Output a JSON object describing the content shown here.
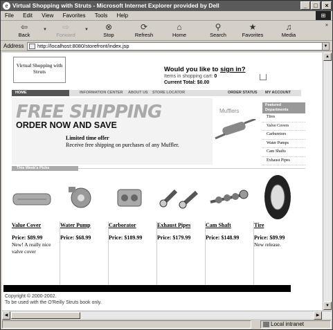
{
  "window": {
    "title": "Virtual Shopping with Struts - Microsoft Internet Explorer provided by Dell",
    "minimize": "_",
    "maximize": "□",
    "close": "×"
  },
  "menu": [
    "File",
    "Edit",
    "View",
    "Favorites",
    "Tools",
    "Help"
  ],
  "toolbar": {
    "back": "Back",
    "forward": "Forward",
    "stop": "Stop",
    "refresh": "Refresh",
    "home": "Home",
    "search": "Search",
    "favorites": "Favorites",
    "media": "Media"
  },
  "address": {
    "label": "Address",
    "url": "http://localhost:8080/storefront/index.jsp"
  },
  "header": {
    "logo": "Virtual Shopping with Struts",
    "question": "Would you like to",
    "signin": "sign in?",
    "cart_label": "Items in shopping cart:",
    "cart_count": "0",
    "total_label": "Current Total:",
    "total_value": "$0.00"
  },
  "nav": {
    "home": "HOME",
    "items": [
      "INFORMATION CENTER",
      "ABOUT US",
      "STORE LOCATOR"
    ],
    "right_items": [
      "ORDER STATUS",
      "MY ACCOUNT"
    ]
  },
  "banner": {
    "headline": "FREE SHIPPING",
    "subhead": "ORDER NOW AND SAVE",
    "offer_title": "Limited time offer",
    "offer_text": "Receive free shipping on purchases of any Muffler.",
    "product_label": "Mufflers"
  },
  "featured": {
    "heading": "Featured Departments",
    "items": [
      "Tires",
      "Valve Covers",
      "Carburetors",
      "Water Pumps",
      "Cam Shafts",
      "Exhaust Pipes"
    ]
  },
  "picks": {
    "heading": "This Week's Picks"
  },
  "products": [
    {
      "name": "Value Cover",
      "price": "Price: $89.99",
      "desc": "New! A really nice valve cover"
    },
    {
      "name": "Water Pump",
      "price": "Price: $68.99",
      "desc": ""
    },
    {
      "name": "Carborator",
      "price": "Price: $189.99",
      "desc": ""
    },
    {
      "name": "Exhaust Pipes",
      "price": "Price: $179.99",
      "desc": ""
    },
    {
      "name": "Cam Shaft",
      "price": "Price: $148.99",
      "desc": ""
    },
    {
      "name": "Tire",
      "price": "Price: $89.99",
      "desc": "New release."
    }
  ],
  "footer": {
    "copyright": "Copyright © 2000-2002.",
    "note": "To be used with the O'Reilly Struts book only."
  },
  "status": {
    "zone": "Local intranet"
  }
}
